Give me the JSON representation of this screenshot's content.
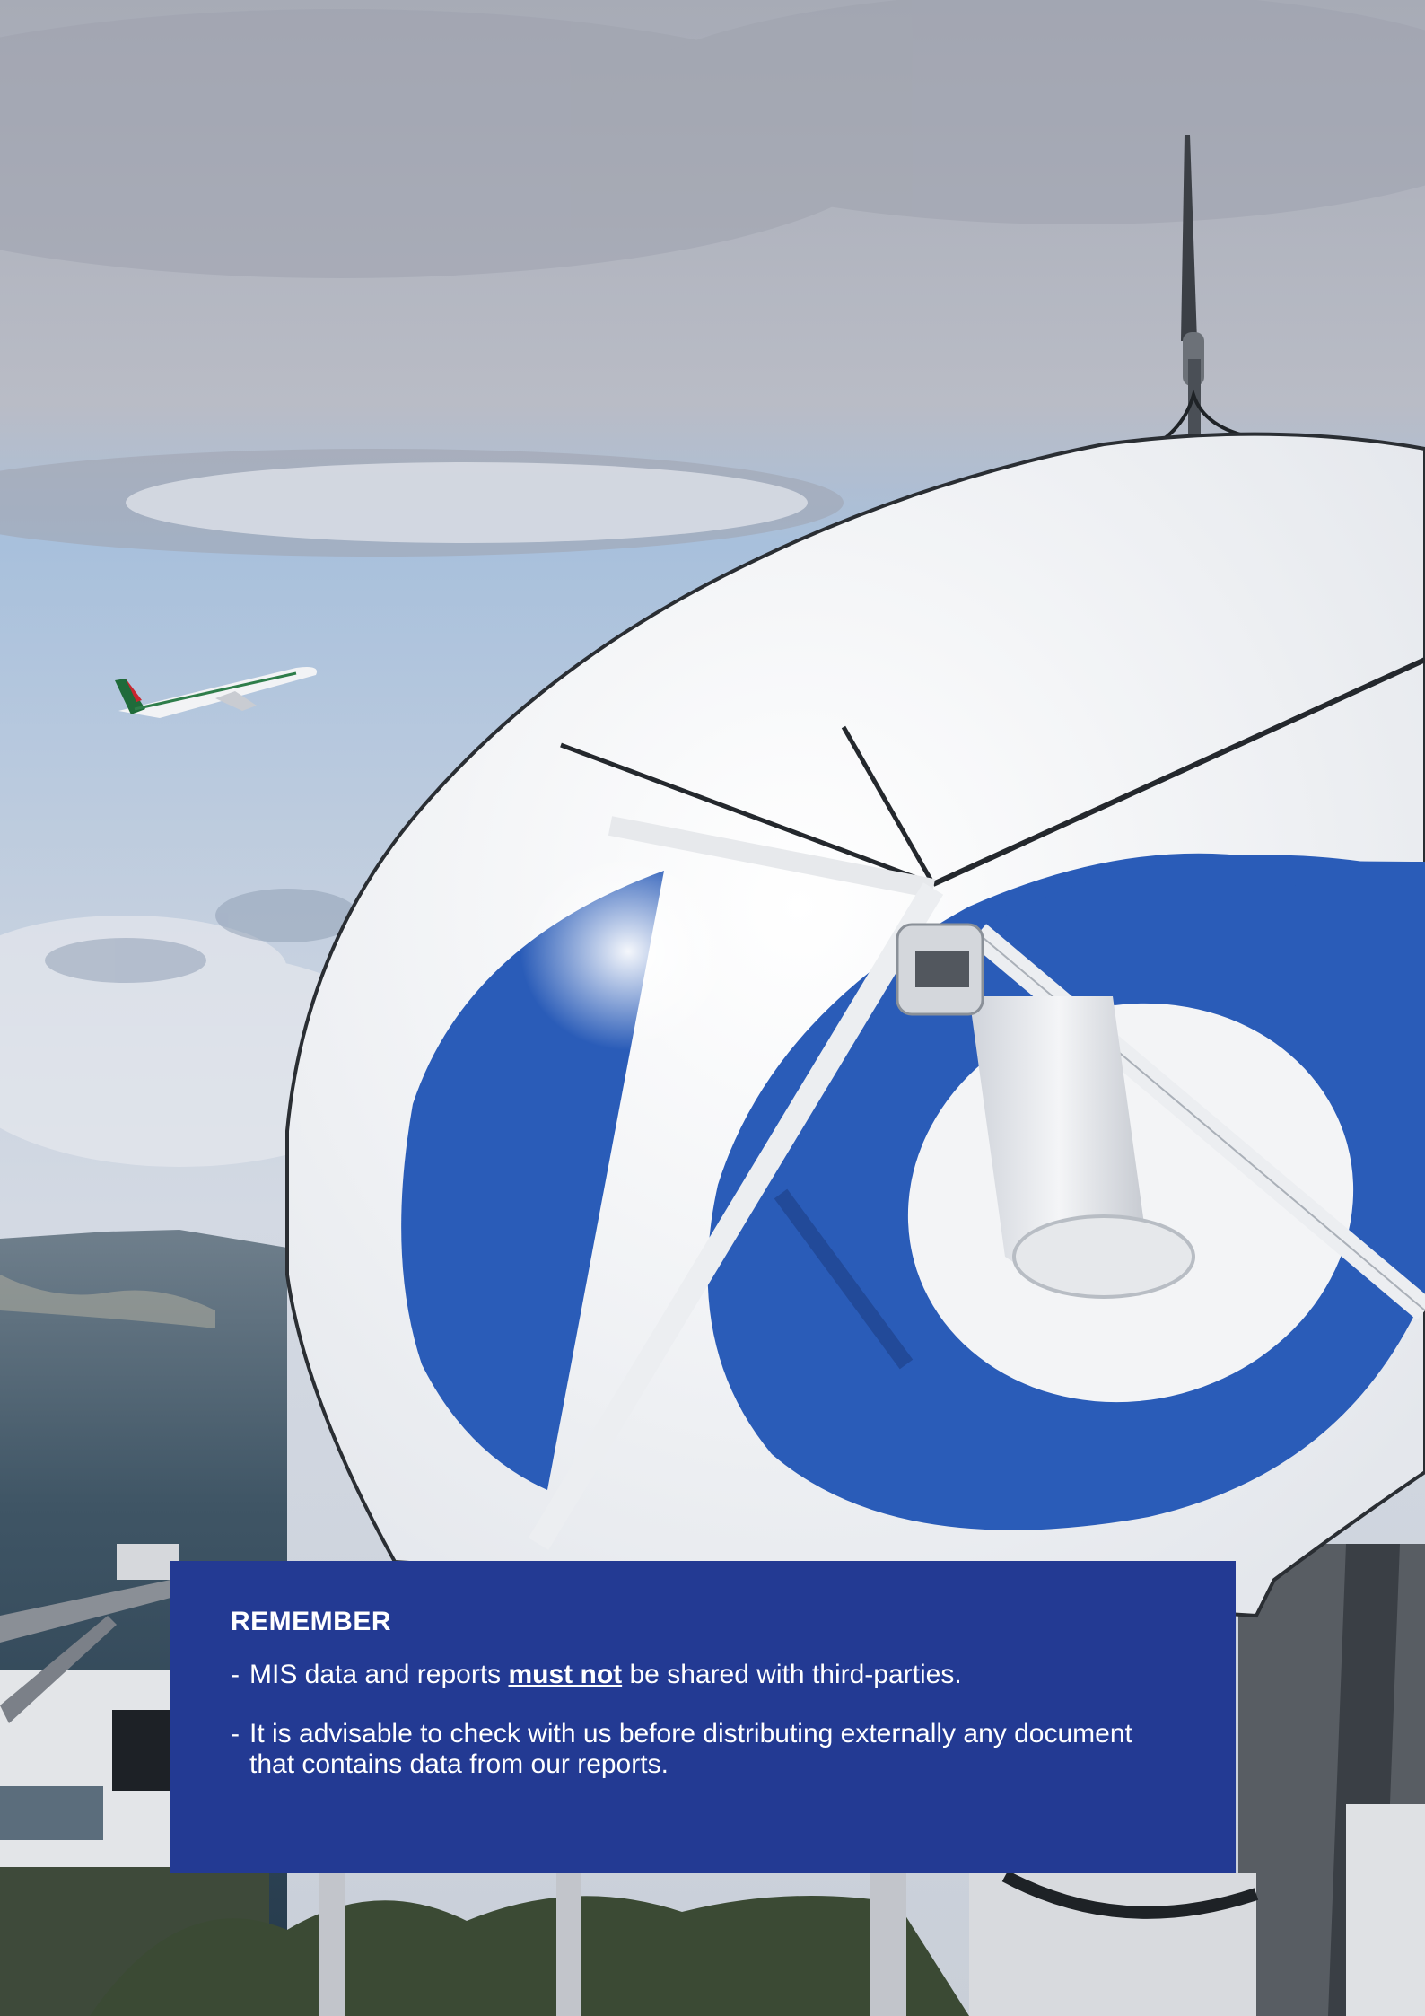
{
  "callout": {
    "title": "REMEMBER",
    "items": [
      {
        "dash": "-",
        "before": "MIS data and reports ",
        "emphasis": "must not",
        "after": " be shared with third-parties."
      },
      {
        "dash": "-",
        "text": "It is advisable to check with us before distributing externally any document that contains data from our reports."
      }
    ]
  },
  "colors": {
    "callout_background": "#233a93",
    "callout_text": "#ffffff",
    "dish_blue": "#2a5cb8"
  }
}
